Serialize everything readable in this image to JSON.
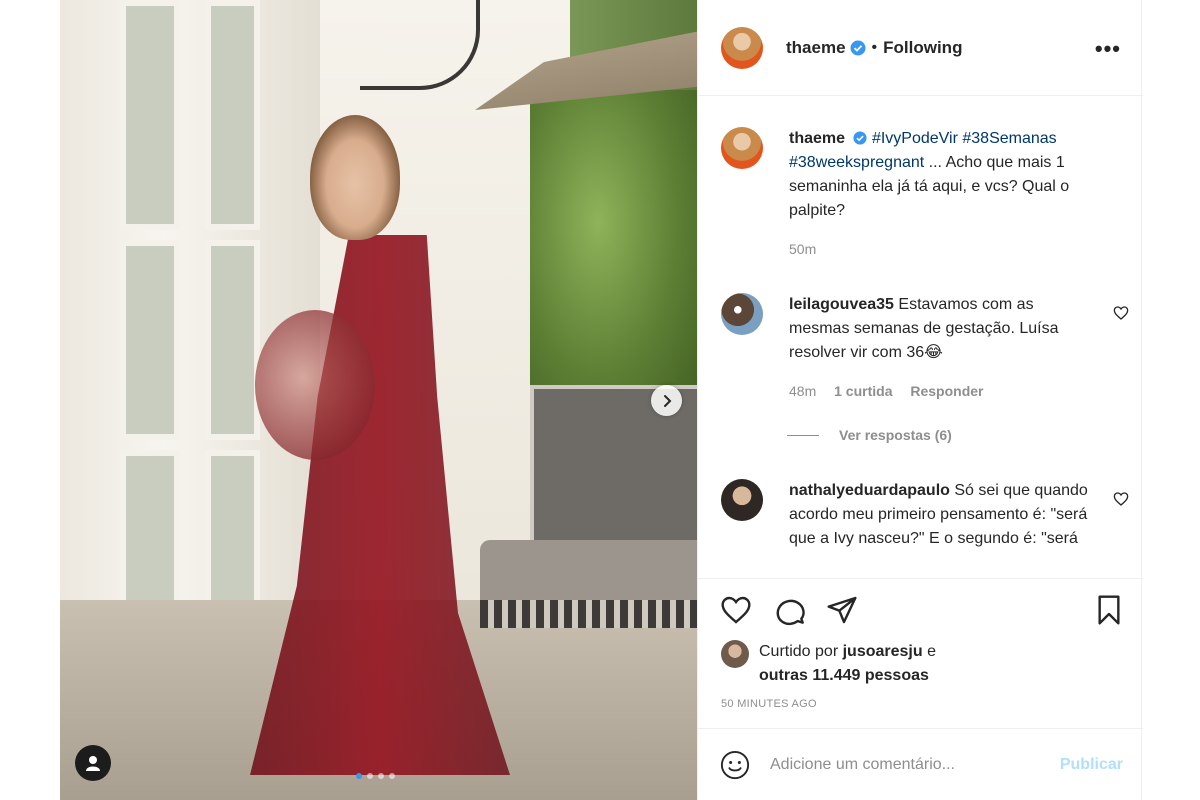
{
  "post": {
    "carousel": {
      "slide_count": 4,
      "active_index": 0
    },
    "dress_color": "#8e1421"
  },
  "header": {
    "username": "thaeme",
    "separator": "•",
    "follow_status": "Following",
    "more_label": "•••"
  },
  "caption": {
    "username": "thaeme",
    "hashtag1": "#IvyPodeVir",
    "hashtag2": "#38Semanas",
    "hashtag3": "#38weekspregnant",
    "text": " ... Acho que mais 1 semaninha ela já tá aqui, e vcs? Qual o palpite?",
    "time": "50m"
  },
  "comments": [
    {
      "username": "leilagouvea35",
      "text": "Estavamos com as mesmas semanas de gestação. Luísa resolver vir com 36😂",
      "time": "48m",
      "likes": "1 curtida",
      "reply": "Responder",
      "view_replies": "Ver respostas (6)"
    },
    {
      "username": "nathalyeduardapaulo",
      "text": "Só sei que quando acordo meu primeiro pensamento é: \"será que a Ivy nasceu?\" E o segundo é: \"será"
    }
  ],
  "likes": {
    "prefix": "Curtido por ",
    "user": "jusoaresju",
    "middle": " e",
    "others": "outras 11.449 pessoas"
  },
  "posted_ago": "50 MINUTES AGO",
  "add_comment": {
    "placeholder": "Adicione um comentário...",
    "publish_label": "Publicar"
  },
  "colors": {
    "verified": "#3897f0",
    "hashtag": "#00376b",
    "publish_disabled": "#b2dffc"
  }
}
